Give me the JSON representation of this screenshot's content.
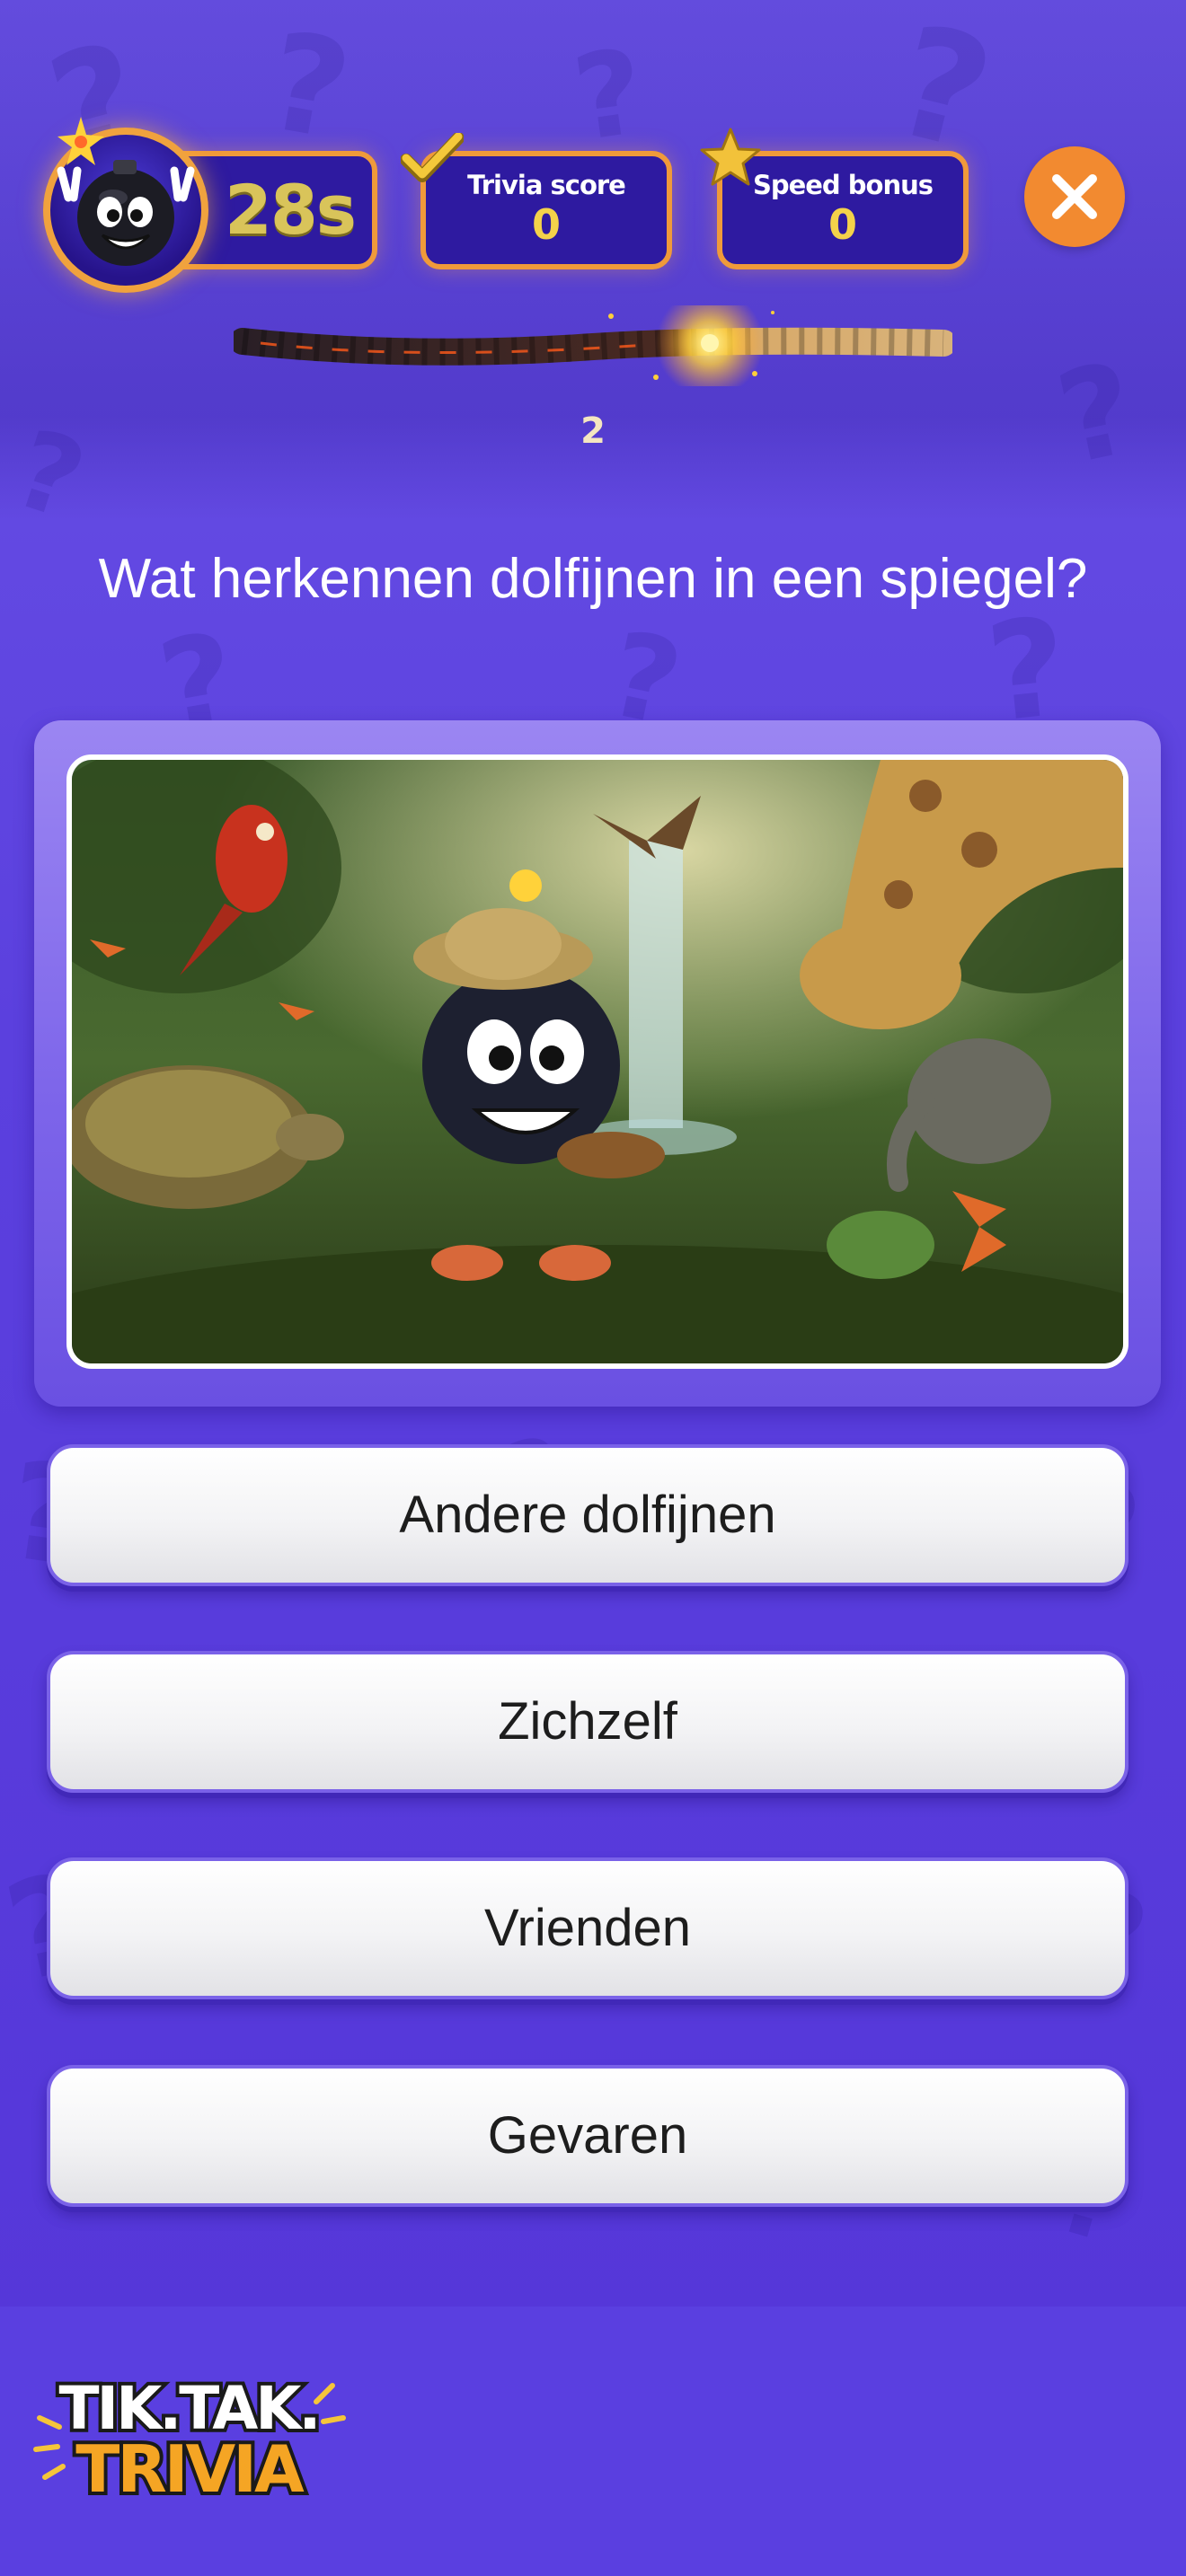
{
  "hud": {
    "timer": "28s",
    "trivia_score_label": "Trivia score",
    "trivia_score_value": "0",
    "speed_bonus_label": "Speed bonus",
    "speed_bonus_value": "0",
    "question_number": "2",
    "fuse_burned_fraction": 0.65
  },
  "question": {
    "text": "Wat herkennen dolfijnen in een spiegel?"
  },
  "answers": [
    {
      "label": "Andere dolfijnen"
    },
    {
      "label": "Zichzelf"
    },
    {
      "label": "Vrienden"
    },
    {
      "label": "Gevaren"
    }
  ],
  "footer": {
    "logo_line1": "TIK.TAK.",
    "logo_line2": "TRIVIA"
  },
  "colors": {
    "background": "#5b40de",
    "hud_box": "#2e1aa0",
    "hud_border": "#f09a3a",
    "close_button": "#f28a30",
    "score_value": "#f4d24a"
  },
  "icons": {
    "avatar": "bomb-mascot-icon",
    "trivia_score": "checkmark-icon",
    "speed_bonus": "star-icon",
    "close": "close-icon",
    "fuse": "burning-fuse-icon"
  }
}
